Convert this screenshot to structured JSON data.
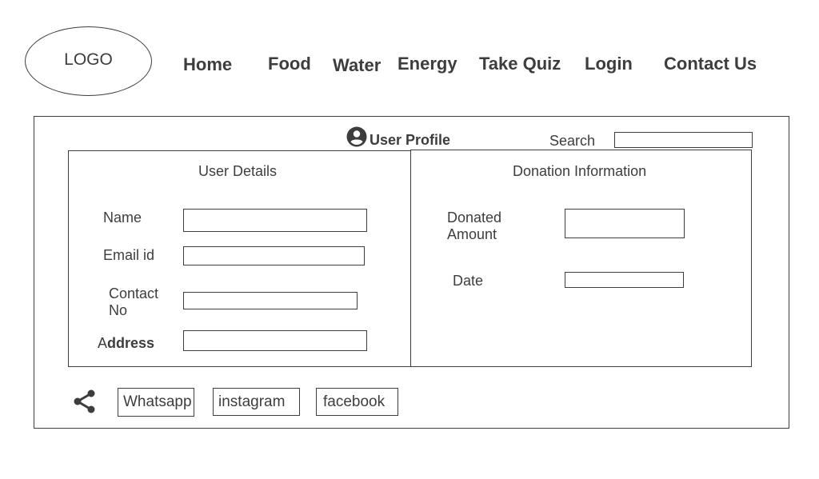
{
  "header": {
    "logo_text": "LOGO",
    "nav": {
      "home": "Home",
      "food": "Food",
      "water": "Water",
      "energy": "Energy",
      "quiz": "Take Quiz",
      "login": "Login",
      "contact": "Contact Us"
    }
  },
  "profile": {
    "title": "User Profile",
    "icon": "user-circle-icon",
    "search_label": "Search",
    "search_value": ""
  },
  "user_details": {
    "heading": "User Details",
    "name_label": "Name",
    "name_value": "",
    "email_label": "Email id",
    "email_value": "",
    "contact_label_1": "Contact",
    "contact_label_2": "No",
    "contact_value": "",
    "address_label_prefix": "A",
    "address_label_rest": "ddress",
    "address_value": ""
  },
  "donation": {
    "heading": "Donation Information",
    "amount_label_1": "Donated",
    "amount_label_2": "Amount",
    "amount_value": "",
    "date_label": "Date",
    "date_value": ""
  },
  "share": {
    "icon": "share-icon",
    "whatsapp": "Whatsapp",
    "instagram": "instagram",
    "facebook": "facebook"
  },
  "colors": {
    "stroke": "#3d3d3d",
    "background": "#ffffff"
  }
}
